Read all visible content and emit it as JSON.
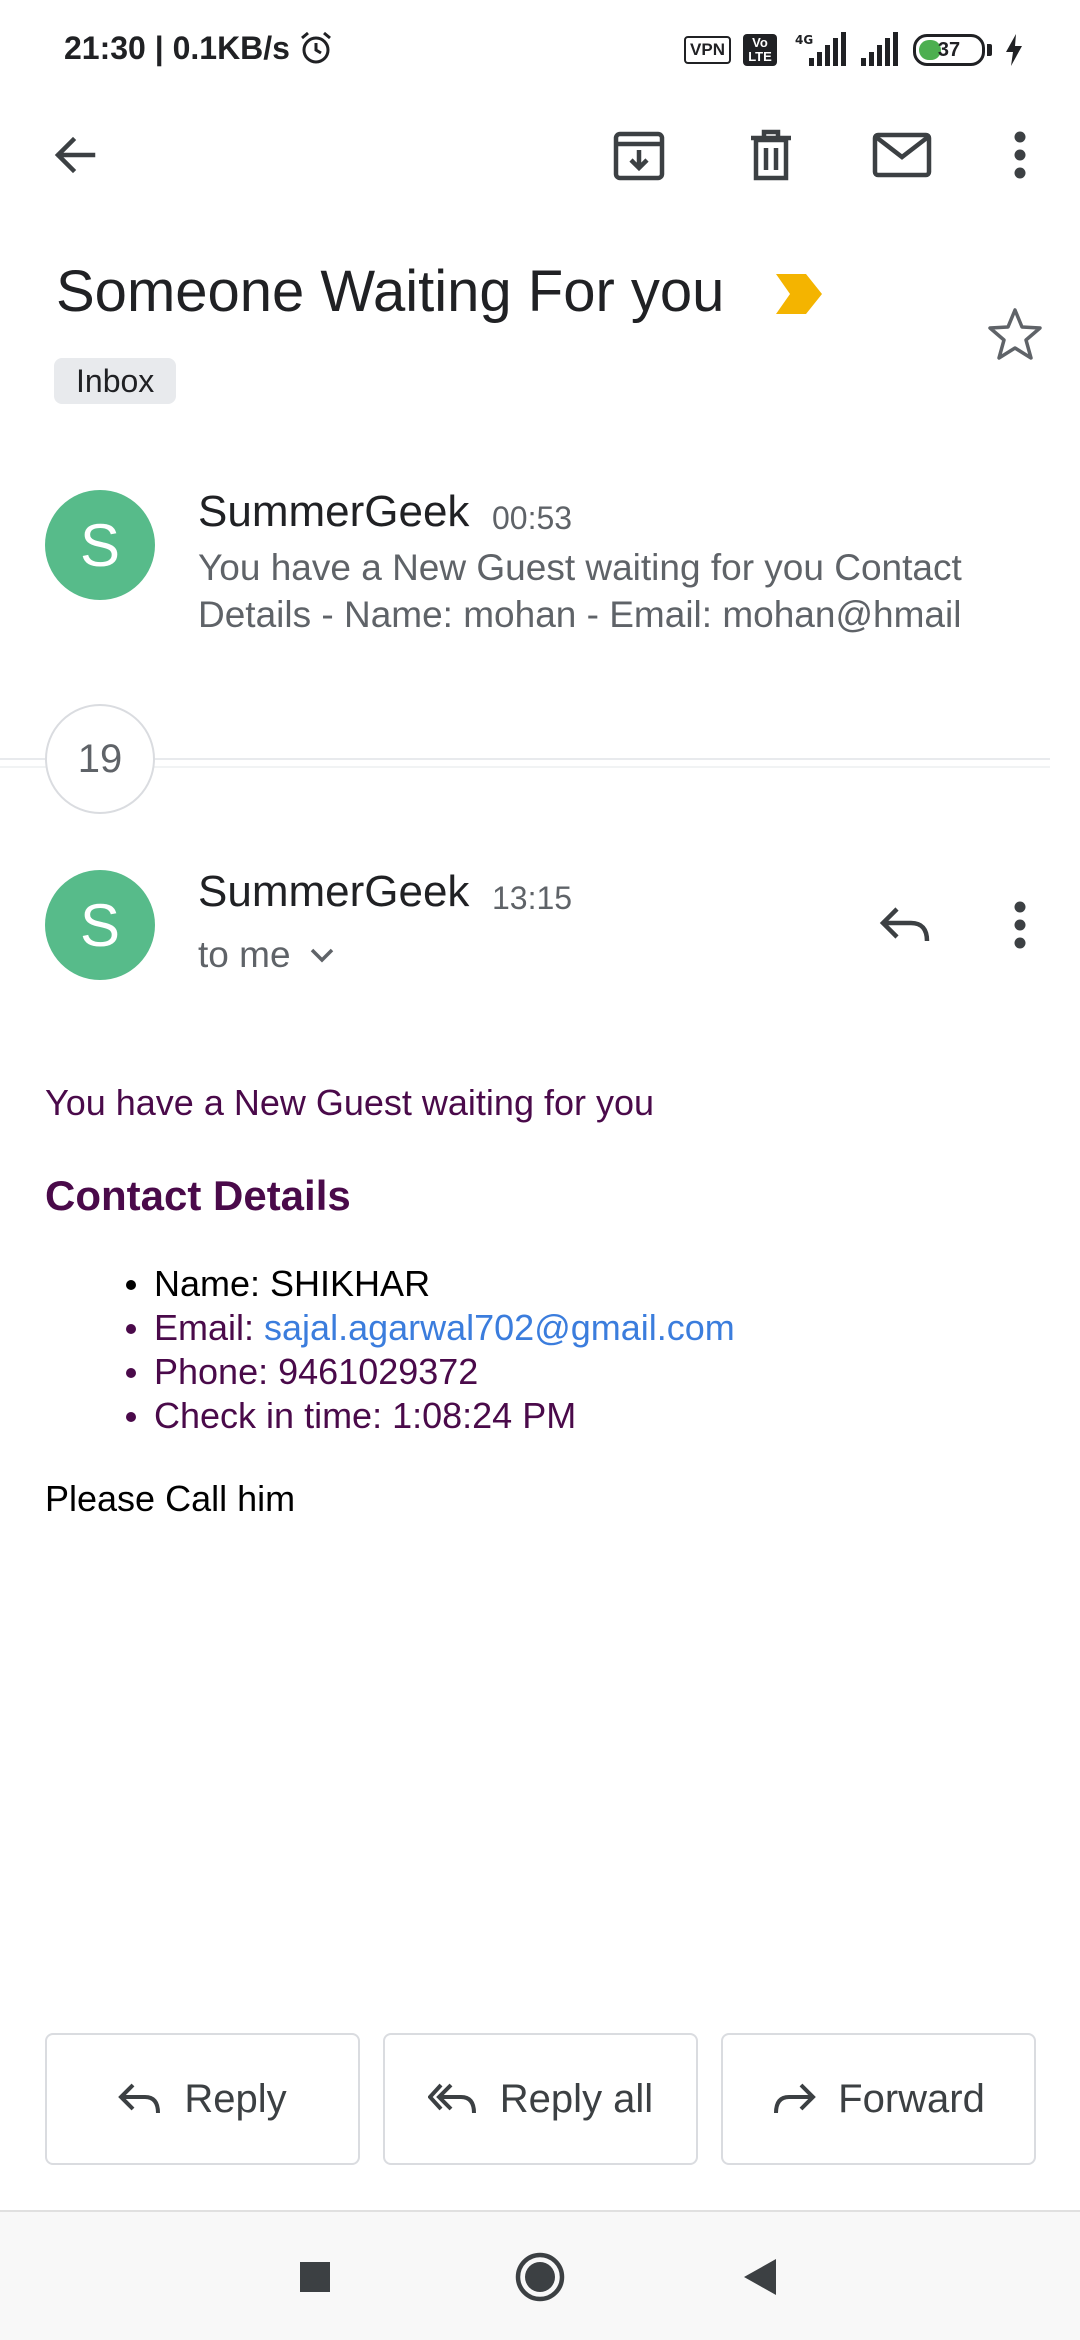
{
  "status_bar": {
    "time_speed": "21:30 | 0.1KB/s",
    "vpn": "VPN",
    "volte": "Vo LTE",
    "network": "4G",
    "battery": "37",
    "battery_level": 0.37
  },
  "toolbar": {
    "icons": [
      "back-arrow-icon",
      "archive-icon",
      "delete-icon",
      "mark-unread-icon",
      "more-vert-icon"
    ]
  },
  "email": {
    "subject": "Someone Waiting For you",
    "label": "Inbox",
    "collapsed_message": {
      "avatar_letter": "S",
      "sender": "SummerGeek",
      "time": "00:53",
      "snippet": "You have a New Guest waiting for you Contact Details - Name: mohan - Email: mohan@hmail"
    },
    "hidden_count": "19",
    "open_message": {
      "avatar_letter": "S",
      "sender": "SummerGeek",
      "time": "13:15",
      "recipient": "to me",
      "body_intro": "You have a New Guest waiting for you",
      "body_heading": "Contact Details",
      "details": {
        "name": "Name: SHIKHAR",
        "email_prefix": "Email: ",
        "email": "sajal.agarwal702@gmail.com",
        "phone": "Phone: 9461029372",
        "checkin": "Check in time: 1:08:24 PM"
      },
      "closing": "Please Call him"
    }
  },
  "actions": {
    "reply": "Reply",
    "reply_all": "Reply all",
    "forward": "Forward"
  },
  "colors": {
    "avatar": "#57bb8a",
    "importance": "#f4b400",
    "body_text": "#4a0a4a",
    "link": "#3b7ddd"
  }
}
